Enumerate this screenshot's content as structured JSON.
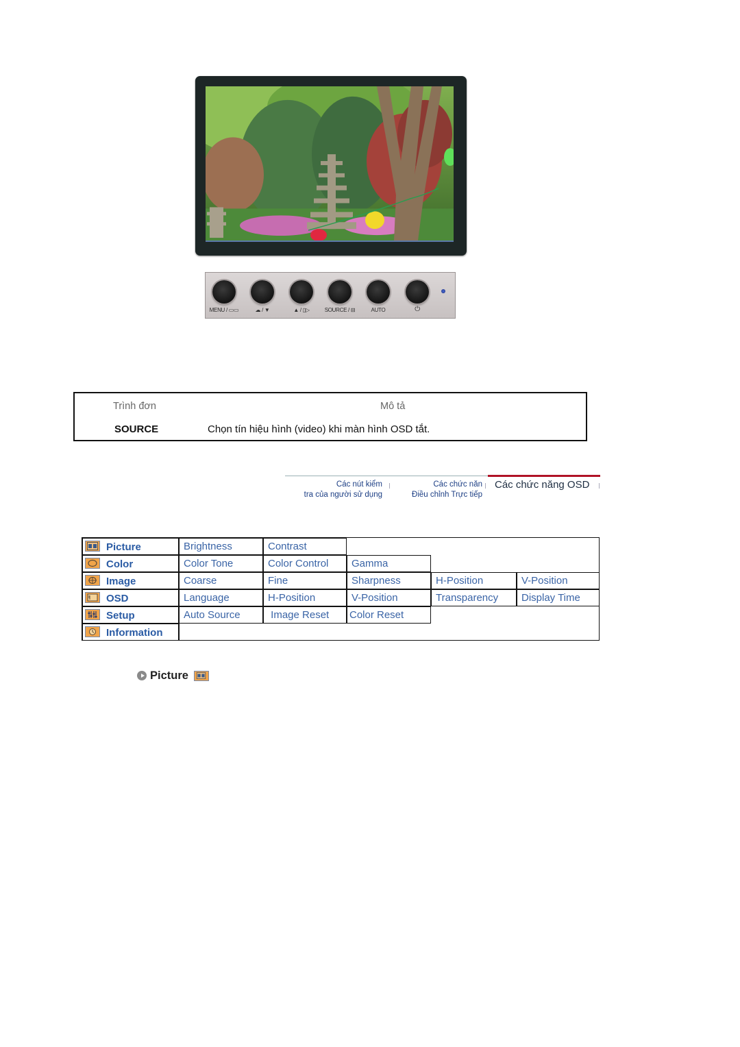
{
  "monitor": {
    "image_alt": "Garden scene with stone pagoda, trees and paper lanterns"
  },
  "control_panel": {
    "buttons": [
      {
        "label": "MENU / ▭▭",
        "icon": "menu-icon"
      },
      {
        "label": "☁ / ▼",
        "icon": "brightness-down-icon"
      },
      {
        "label": "▲ / ▯▷",
        "icon": "up-volume-icon"
      },
      {
        "label": "SOURCE / ⊟",
        "icon": "source-icon"
      },
      {
        "label": "AUTO",
        "icon": "auto-icon"
      },
      {
        "label": "⏻",
        "icon": "power-icon"
      }
    ],
    "led_color": "#3455c0"
  },
  "description_table": {
    "header_menu": "Trình đơn",
    "header_description": "Mô tả",
    "rows": [
      {
        "menu": "SOURCE",
        "description": "Chọn tín hiệu hình (video) khi màn hình OSD tắt."
      }
    ]
  },
  "nav_tabs": [
    {
      "label_line1": "Các nút kiểm",
      "label_line2": "tra của người sử dụng",
      "active": false
    },
    {
      "label_line1": "Các chức năn",
      "label_line2": "Điều chỉnh Trực tiếp",
      "active": false
    },
    {
      "label_line1": "Các chức năng OSD",
      "label_line2": "",
      "active": true
    }
  ],
  "osd_menu": {
    "categories": [
      {
        "label": "Picture",
        "icon": "picture-icon",
        "items": [
          "Brightness",
          "Contrast"
        ]
      },
      {
        "label": "Color",
        "icon": "color-icon",
        "items": [
          "Color Tone",
          "Color Control",
          "Gamma"
        ]
      },
      {
        "label": "Image",
        "icon": "image-icon",
        "items": [
          "Coarse",
          "Fine",
          "Sharpness",
          "H-Position",
          "V-Position"
        ]
      },
      {
        "label": "OSD",
        "icon": "osd-icon",
        "items": [
          "Language",
          "H-Position",
          "V-Position",
          "Transparency",
          "Display Time"
        ]
      },
      {
        "label": "Setup",
        "icon": "setup-icon",
        "items": [
          "Auto Source",
          " Image Reset",
          "Color Reset"
        ]
      },
      {
        "label": "Information",
        "icon": "information-icon",
        "items": []
      }
    ]
  },
  "section": {
    "title": "Picture"
  },
  "colors": {
    "link_blue": "#3a64a6",
    "category_blue": "#2a5ba4",
    "active_tab_red": "#b01226",
    "icon_orange": "#f0a44a"
  }
}
